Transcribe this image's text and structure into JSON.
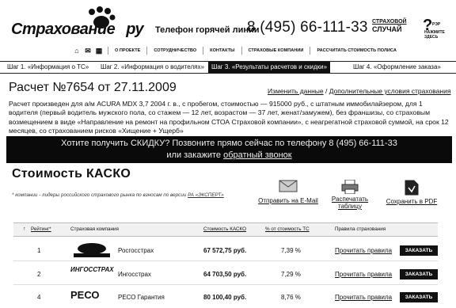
{
  "header": {
    "logo_text": "Страхование",
    "logo_text2": "ру",
    "hotline_label": "Телефон горячей линии",
    "hotline_phone": "8 (495) 66-111-33",
    "case_logo": {
      "line1": "СТРАХОВОЙ",
      "line2": "СЛУЧАЙ",
      "line3": "РЭР",
      "line4": "НАЖМИТЕ ЗДЕСЬ"
    }
  },
  "nav": {
    "items": [
      "О ПРОЕКТЕ",
      "СОТРУДНИЧЕСТВО",
      "КОНТАКТЫ",
      "СТРАХОВЫЕ КОМПАНИИ",
      "РАССЧИТАТЬ СТОИМОСТЬ ПОЛИСА"
    ]
  },
  "steps": {
    "s1": "Шаг 1. «Информация о ТС»",
    "s2": "Шаг 2. «Информация о водителях»",
    "s3": "Шаг 3. «Результаты расчетов и скидки»",
    "s4": "Шаг 4. «Оформление заказа»"
  },
  "calc": {
    "title": "Расчет №7654 от 27.11.2009",
    "link_change": "Изменить данные",
    "link_sep": " / ",
    "link_extra": "Дополнительные условия страхования",
    "desc": "Расчет произведен для а/м ACURA MDX 3,7 2004 г. в., с пробегом, стоимостью — 915000 руб., с штатным иммобилайзером, для 1 водителя (первый водитель мужского пола, со стажем — 12 лет, возрастом — 37 лет, женат/замужем), без франшизы, со страховым возмещением в виде «Направление на ремонт на профильном СТОА Страховой компании», с неагрегатной страховой суммой, на срок 12 месяцев, со страхованием рисков «Хищение + Ущерб»"
  },
  "banner": {
    "line1": "Хотите получить СКИДКУ? Позвоните прямо сейчас по телефону 8 (495) 66-111-33",
    "line2_prefix": "или закажите ",
    "line2_link": "обратный звонок"
  },
  "kasko": {
    "title": "Стоимость КАСКО",
    "note_prefix": "* компании - лидеры российского страхового рынка по взносам по версии ",
    "note_link": "РА «ЭКСПЕРТ»"
  },
  "actions": {
    "email": "Отправить на E-Mail",
    "print_line1": "Распечатать",
    "print_line2": "таблицу",
    "pdf": "Сохранить в PDF"
  },
  "table": {
    "headers": {
      "rating": "Рейтинг*",
      "company": "Страховая компания",
      "cost": "Стоимость КАСКО",
      "percent": "% от стоимость ТС",
      "rules": "Правила страхования"
    },
    "rows": [
      {
        "n": "1",
        "logo": "РОСГОССТРАХ",
        "company": "Росгосстрах",
        "price": "67 572,75 руб.",
        "percent": "7,39 %",
        "rules": "Прочитать правила",
        "order": "ЗАКАЗАТЬ"
      },
      {
        "n": "2",
        "logo": "ИНГОССТРАХ",
        "company": "Ингосстрах",
        "price": "64 703,50 руб.",
        "percent": "7,29 %",
        "rules": "Прочитать правила",
        "order": "ЗАКАЗАТЬ"
      },
      {
        "n": "4",
        "logo": "РЕСО",
        "company": "РЕСО Гарантия",
        "price": "80 100,40 руб.",
        "percent": "8,76 %",
        "rules": "Прочитать правила",
        "order": "ЗАКАЗАТЬ"
      }
    ]
  },
  "colors": {
    "banner_bg": "#0a0a0a",
    "button_bg": "#111111",
    "text": "#111111"
  }
}
